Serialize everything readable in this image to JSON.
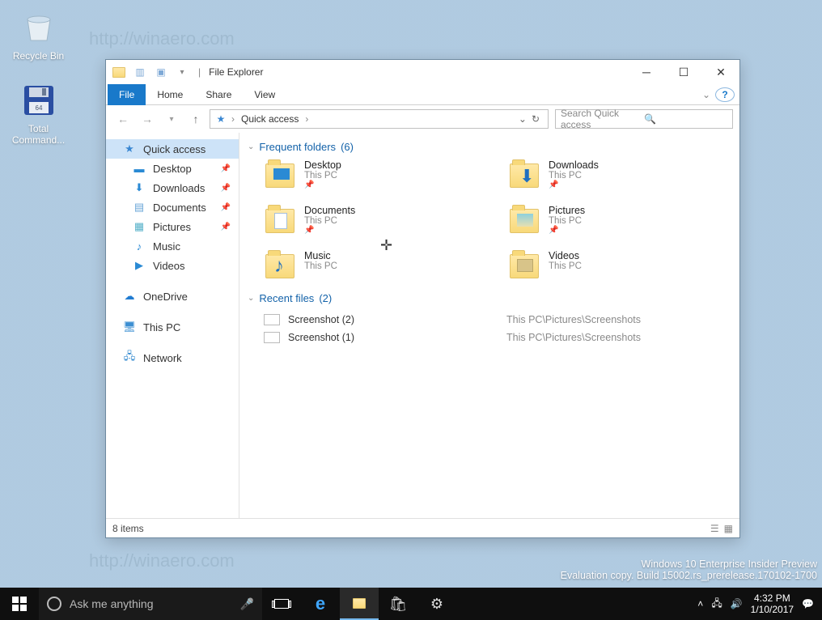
{
  "desktop": {
    "icons": [
      {
        "name": "recycle-bin",
        "label": "Recycle Bin"
      },
      {
        "name": "total-commander",
        "label": "Total Command..."
      }
    ]
  },
  "watermarks": [
    "http://winaero.com",
    "http://winaero.com",
    "http://winaero.com",
    "http://winaero.com",
    "http://winaero.com",
    "http://winaero.com"
  ],
  "window": {
    "title": "File Explorer",
    "ribbon": {
      "file": "File",
      "tabs": [
        "Home",
        "Share",
        "View"
      ]
    },
    "nav": {
      "breadcrumb": [
        "Quick access"
      ]
    },
    "search": {
      "placeholder": "Search Quick access"
    },
    "tree": {
      "quick_access": "Quick access",
      "items": [
        {
          "label": "Desktop",
          "pinned": true
        },
        {
          "label": "Downloads",
          "pinned": true
        },
        {
          "label": "Documents",
          "pinned": true
        },
        {
          "label": "Pictures",
          "pinned": true
        },
        {
          "label": "Music",
          "pinned": false
        },
        {
          "label": "Videos",
          "pinned": false
        }
      ],
      "onedrive": "OneDrive",
      "thispc": "This PC",
      "network": "Network"
    },
    "content": {
      "section_folders": {
        "title": "Frequent folders",
        "count": 6
      },
      "folders": [
        {
          "name": "Desktop",
          "loc": "This PC",
          "pinned": true
        },
        {
          "name": "Downloads",
          "loc": "This PC",
          "pinned": true
        },
        {
          "name": "Documents",
          "loc": "This PC",
          "pinned": true
        },
        {
          "name": "Pictures",
          "loc": "This PC",
          "pinned": true
        },
        {
          "name": "Music",
          "loc": "This PC",
          "pinned": false
        },
        {
          "name": "Videos",
          "loc": "This PC",
          "pinned": false
        }
      ],
      "section_recent": {
        "title": "Recent files",
        "count": 2
      },
      "recent": [
        {
          "name": "Screenshot (2)",
          "path": "This PC\\Pictures\\Screenshots"
        },
        {
          "name": "Screenshot (1)",
          "path": "This PC\\Pictures\\Screenshots"
        }
      ]
    },
    "status": {
      "items": "8 items"
    }
  },
  "buildinfo": {
    "line1": "Windows 10 Enterprise Insider Preview",
    "line2": "Evaluation copy. Build 15002.rs_prerelease.170102-1700"
  },
  "taskbar": {
    "search_placeholder": "Ask me anything",
    "clock_time": "4:32 PM",
    "clock_date": "1/10/2017"
  }
}
